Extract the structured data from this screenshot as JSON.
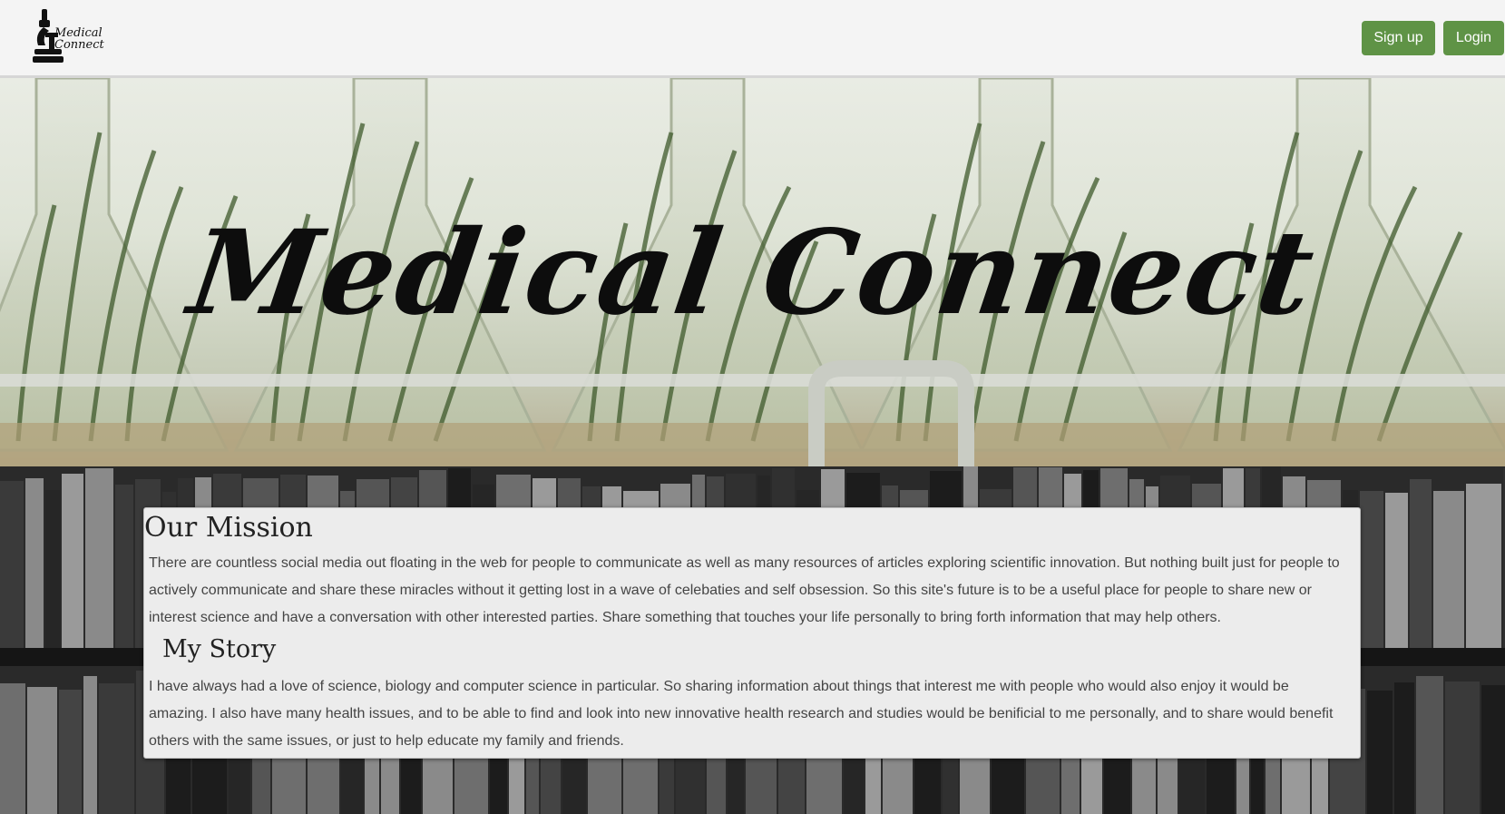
{
  "header": {
    "logo_text": "Medical\nConnect",
    "signup_label": "Sign up",
    "login_label": "Login"
  },
  "hero": {
    "title": "Medical Connect"
  },
  "mission": {
    "heading": "Our Mission",
    "text": "There are countless social media out floating in the web for people to communicate as well as many resources of articles exploring scientific innovation. But nothing built just for people to actively communicate and share these miracles without it getting lost in a wave of celebaties and self obsession. So this site's future is to be a useful place for people to share new or interest science and have a conversation with other interested parties. Share something that touches your life personally to bring forth information that may help others."
  },
  "story": {
    "heading": "My Story",
    "text": "I have always had a love of science, biology and computer science in particular. So sharing information about things that interest me with people who would also enjoy it would be amazing. I also have many health issues, and to be able to find and look into new innovative health research and studies would be benificial to me personally, and to share would benefit others with the same issues, or just to help educate my family and friends."
  },
  "colors": {
    "button": "#5f9346",
    "panel": "#ececec",
    "header": "#f4f4f4"
  },
  "icons": {
    "logo": "microscope-icon"
  }
}
